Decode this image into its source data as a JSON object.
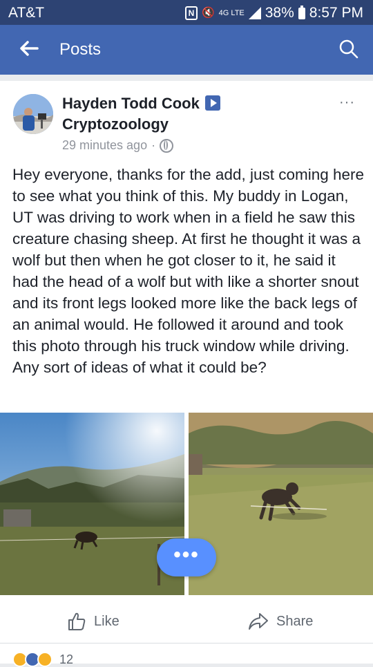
{
  "status_bar": {
    "carrier": "AT&T",
    "network": "4G LTE",
    "battery": "38%",
    "time": "8:57 PM"
  },
  "app_bar": {
    "title": "Posts",
    "back_icon": "arrow-left-icon",
    "search_icon": "search-icon"
  },
  "post": {
    "author": "Hayden Todd Cook",
    "group": "Cryptozoology",
    "time": "29 minutes ago",
    "separator": "·",
    "privacy_icon": "globe-icon",
    "more_label": "···",
    "text": "Hey everyone, thanks for the add, just coming here to see what you think of this. My buddy in Logan, UT was driving to work when in a field he saw this creature chasing sheep. At first he thought it was a wolf but then when he got closer to it, he said it had the head of a wolf but with like a shorter snout and its front legs looked more like the back legs of an animal would. He followed it around and took this photo through his truck window while driving. Any sort of ideas of what it could be?",
    "photos": [
      "field-photo-wide",
      "field-photo-close"
    ]
  },
  "actions": {
    "like_label": "Like",
    "share_label": "Share",
    "fab_label": "•••"
  },
  "reactions": {
    "count": "12"
  },
  "colors": {
    "status_bar": "#2d4373",
    "app_bar": "#4267b2",
    "fab": "#5890ff",
    "text": "#1d2129",
    "meta": "#90949c"
  }
}
